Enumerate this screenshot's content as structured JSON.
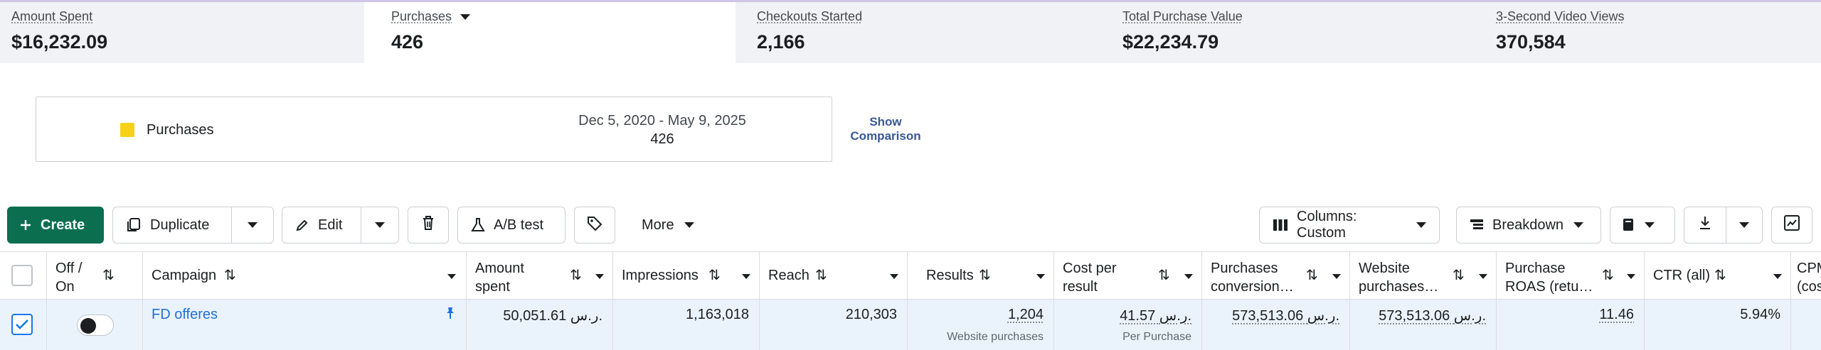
{
  "metrics": [
    {
      "label": "Amount Spent",
      "value": "$16,232.09"
    },
    {
      "label": "Purchases",
      "value": "426"
    },
    {
      "label": "Checkouts Started",
      "value": "2,166"
    },
    {
      "label": "Total Purchase Value",
      "value": "$22,234.79"
    },
    {
      "label": "3-Second Video Views",
      "value": "370,584"
    }
  ],
  "chart": {
    "legend_label": "Purchases",
    "legend_color": "#f7d117",
    "date_range": "Dec 5, 2020 - May 9, 2025",
    "value": "426",
    "show_comparison": "Show Comparison"
  },
  "toolbar": {
    "create": "Create",
    "duplicate": "Duplicate",
    "edit": "Edit",
    "ab_test": "A/B test",
    "more": "More",
    "columns": "Columns: Custom",
    "breakdown": "Breakdown"
  },
  "table": {
    "headers": {
      "off_on": "Off / On",
      "campaign": "Campaign",
      "amount_spent": "Amount spent",
      "impressions": "Impressions",
      "reach": "Reach",
      "results": "Results",
      "cost_per_result": "Cost per result",
      "purchases_conv": "Purchases conversion…",
      "website_purchases": "Website purchases…",
      "purchase_roas": "Purchase ROAS (retu…",
      "ctr": "CTR (all)",
      "cpm": "CPM (cost per"
    },
    "row": {
      "campaign": "FD offeres",
      "amount_spent": "50,051.61 ر.س.",
      "impressions": "1,163,018",
      "reach": "210,303",
      "results": "1,204",
      "results_sub": "Website purchases",
      "cost_per_result": "41.57 ر.س.",
      "cost_per_result_sub": "Per Purchase",
      "purchases_conv": "573,513.06 ر.س.",
      "website_purchases": "573,513.06 ر.س.",
      "purchase_roas": "11.46",
      "ctr": "5.94%"
    }
  },
  "colors": {
    "accent_green": "#0a6e4f",
    "link_blue": "#216fdb",
    "row_selected": "#eaf3fb"
  }
}
